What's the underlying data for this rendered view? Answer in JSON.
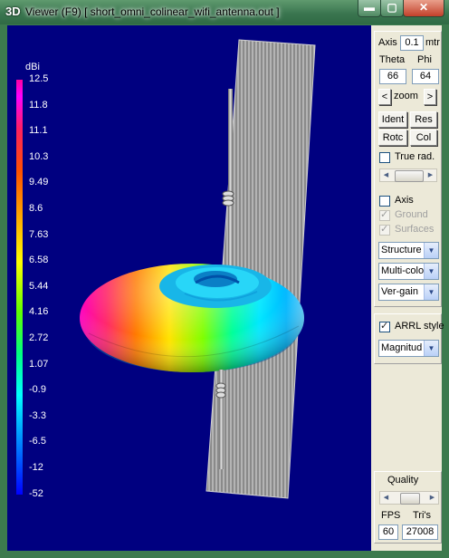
{
  "window": {
    "icon_text": "3D",
    "title": "Viewer (F9)    [ short_omni_colinear_wifi_antenna.out ]",
    "min_glyph": "▬",
    "max_glyph": "▢",
    "close_glyph": "✕"
  },
  "legend": {
    "unit": "dBi",
    "labels": [
      "12.5",
      "11.8",
      "11.1",
      "10.3",
      "9.49",
      "8.6",
      "7.63",
      "6.58",
      "5.44",
      "4.16",
      "2.72",
      "1.07",
      "-0.9",
      "-3.3",
      "-6.5",
      "-12",
      "-52"
    ]
  },
  "panel": {
    "axis_label": "Axis",
    "axis_value": "0.1",
    "axis_unit": "mtr",
    "theta_label": "Theta",
    "phi_label": "Phi",
    "theta_value": "66",
    "phi_value": "64",
    "zoom_left": "<",
    "zoom_label": "zoom",
    "zoom_right": ">",
    "ident": "Ident",
    "res": "Res",
    "rotc": "Rotc",
    "col": "Col",
    "true_rad": "True rad.",
    "axis_check": "Axis",
    "ground": "Ground",
    "surfaces": "Surfaces",
    "select_structure": "Structure",
    "select_color": "Multi-colo",
    "select_gain": "Ver-gain",
    "arrl_style": "ARRL style",
    "select_magnitude": "Magnitud",
    "quality": "Quality",
    "fps_label": "FPS",
    "tris_label": "Tri's",
    "fps_value": "60",
    "tris_value": "27008"
  },
  "state": {
    "true_rad_checked": false,
    "axis_checked": false,
    "ground_checked": true,
    "surfaces_checked": true,
    "arrl_checked": true
  },
  "colors": {
    "viewport_bg": "#000080",
    "frame": "#3c7a4e",
    "panel_bg": "#ece9d8"
  }
}
